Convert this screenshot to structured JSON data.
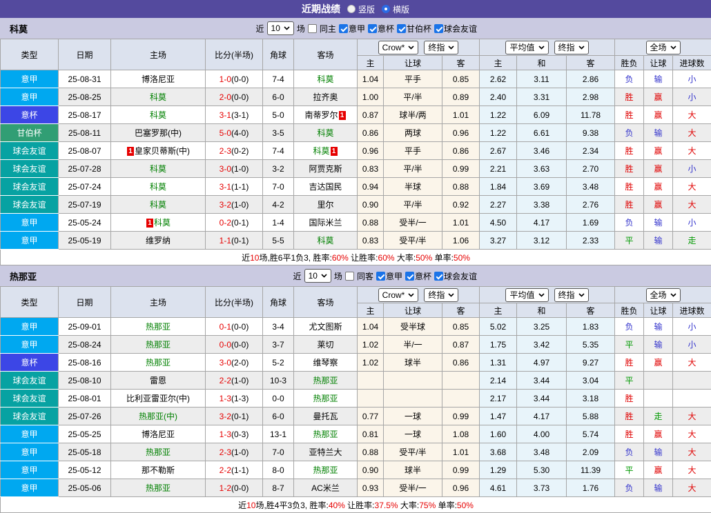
{
  "title_bar": {
    "title": "近期战绩",
    "radio_vertical": {
      "label": "竖版",
      "checked": false
    },
    "radio_horizontal": {
      "label": "横版",
      "checked": true
    }
  },
  "type_colors": {
    "意甲": "#00A8F0",
    "意杯": "#3C46E6",
    "甘伯杯": "#319E74",
    "球会友谊": "#07A2A2"
  },
  "result_colors": {
    "胜": "red",
    "负": "blue",
    "平": "green",
    "赢": "red",
    "输": "blue",
    "走": "green",
    "大": "red",
    "小": "blue"
  },
  "sections": [
    {
      "team": "科莫",
      "filter": {
        "near_label": "近",
        "count": "10",
        "games_label": "场",
        "same_label": "同主",
        "same_checked": false,
        "leagues": [
          {
            "label": "意甲",
            "checked": true
          },
          {
            "label": "意杯",
            "checked": true
          },
          {
            "label": "甘伯杯",
            "checked": true
          },
          {
            "label": "球会友谊",
            "checked": true
          }
        ]
      },
      "header": {
        "cols": [
          "类型",
          "日期",
          "主场",
          "比分(半场)",
          "角球",
          "客场"
        ],
        "selects": {
          "bookmaker": "Crow*",
          "ah_final": "终指",
          "eu_avg": "平均值",
          "eu_final": "终指",
          "scope": "全场"
        },
        "sub": [
          "主",
          "让球",
          "客",
          "主",
          "和",
          "客",
          "胜负",
          "让球",
          "进球数"
        ]
      },
      "rows": [
        {
          "type": "意甲",
          "date": "25-08-31",
          "home": "博洛尼亚",
          "home_green": false,
          "home_card": "",
          "score": "1-0",
          "half": "(0-0)",
          "corner": "7-4",
          "away": "科莫",
          "away_green": true,
          "away_card": "",
          "ah": [
            "1.04",
            "平手",
            "0.85"
          ],
          "eu": [
            "2.62",
            "3.11",
            "2.86"
          ],
          "res": [
            "负",
            "输",
            "小"
          ]
        },
        {
          "type": "意甲",
          "date": "25-08-25",
          "home": "科莫",
          "home_green": true,
          "home_card": "",
          "score": "2-0",
          "half": "(0-0)",
          "corner": "6-0",
          "away": "拉齐奥",
          "away_green": false,
          "away_card": "",
          "ah": [
            "1.00",
            "平/半",
            "0.89"
          ],
          "eu": [
            "2.40",
            "3.31",
            "2.98"
          ],
          "res": [
            "胜",
            "赢",
            "小"
          ]
        },
        {
          "type": "意杯",
          "date": "25-08-17",
          "home": "科莫",
          "home_green": true,
          "home_card": "",
          "score": "3-1",
          "half": "(3-1)",
          "corner": "5-0",
          "away": "南蒂罗尔",
          "away_green": false,
          "away_card": "1",
          "ah": [
            "0.87",
            "球半/两",
            "1.01"
          ],
          "eu": [
            "1.22",
            "6.09",
            "11.78"
          ],
          "res": [
            "胜",
            "赢",
            "大"
          ]
        },
        {
          "type": "甘伯杯",
          "date": "25-08-11",
          "home": "巴塞罗那(中)",
          "home_green": false,
          "home_card": "",
          "score": "5-0",
          "half": "(4-0)",
          "corner": "3-5",
          "away": "科莫",
          "away_green": true,
          "away_card": "",
          "ah": [
            "0.86",
            "两球",
            "0.96"
          ],
          "eu": [
            "1.22",
            "6.61",
            "9.38"
          ],
          "res": [
            "负",
            "输",
            "大"
          ]
        },
        {
          "type": "球会友谊",
          "date": "25-08-07",
          "home": "皇家贝蒂斯(中)",
          "home_green": false,
          "home_card": "1",
          "score": "2-3",
          "half": "(0-2)",
          "corner": "7-4",
          "away": "科莫",
          "away_green": true,
          "away_card": "1",
          "ah": [
            "0.96",
            "平手",
            "0.86"
          ],
          "eu": [
            "2.67",
            "3.46",
            "2.34"
          ],
          "res": [
            "胜",
            "赢",
            "大"
          ]
        },
        {
          "type": "球会友谊",
          "date": "25-07-28",
          "home": "科莫",
          "home_green": true,
          "home_card": "",
          "score": "3-0",
          "half": "(1-0)",
          "corner": "3-2",
          "away": "阿贾克斯",
          "away_green": false,
          "away_card": "",
          "ah": [
            "0.83",
            "平/半",
            "0.99"
          ],
          "eu": [
            "2.21",
            "3.63",
            "2.70"
          ],
          "res": [
            "胜",
            "赢",
            "小"
          ]
        },
        {
          "type": "球会友谊",
          "date": "25-07-24",
          "home": "科莫",
          "home_green": true,
          "home_card": "",
          "score": "3-1",
          "half": "(1-1)",
          "corner": "7-0",
          "away": "吉达国民",
          "away_green": false,
          "away_card": "",
          "ah": [
            "0.94",
            "半球",
            "0.88"
          ],
          "eu": [
            "1.84",
            "3.69",
            "3.48"
          ],
          "res": [
            "胜",
            "赢",
            "大"
          ]
        },
        {
          "type": "球会友谊",
          "date": "25-07-19",
          "home": "科莫",
          "home_green": true,
          "home_card": "",
          "score": "3-2",
          "half": "(1-0)",
          "corner": "4-2",
          "away": "里尔",
          "away_green": false,
          "away_card": "",
          "ah": [
            "0.90",
            "平/半",
            "0.92"
          ],
          "eu": [
            "2.27",
            "3.38",
            "2.76"
          ],
          "res": [
            "胜",
            "赢",
            "大"
          ]
        },
        {
          "type": "意甲",
          "date": "25-05-24",
          "home": "科莫",
          "home_green": true,
          "home_card": "1",
          "score": "0-2",
          "half": "(0-1)",
          "corner": "1-4",
          "away": "国际米兰",
          "away_green": false,
          "away_card": "",
          "ah": [
            "0.88",
            "受半/一",
            "1.01"
          ],
          "eu": [
            "4.50",
            "4.17",
            "1.69"
          ],
          "res": [
            "负",
            "输",
            "小"
          ]
        },
        {
          "type": "意甲",
          "date": "25-05-19",
          "home": "维罗纳",
          "home_green": false,
          "home_card": "",
          "score": "1-1",
          "half": "(0-1)",
          "corner": "5-5",
          "away": "科莫",
          "away_green": true,
          "away_card": "",
          "ah": [
            "0.83",
            "受平/半",
            "1.06"
          ],
          "eu": [
            "3.27",
            "3.12",
            "2.33"
          ],
          "res": [
            "平",
            "输",
            "走"
          ]
        }
      ],
      "summary": [
        {
          "text": "近",
          "red": false
        },
        {
          "text": "10",
          "red": true
        },
        {
          "text": "场,胜6平1负3, 胜率:",
          "red": false
        },
        {
          "text": "60%",
          "red": true
        },
        {
          "text": " 让胜率:",
          "red": false
        },
        {
          "text": "60%",
          "red": true
        },
        {
          "text": " 大率:",
          "red": false
        },
        {
          "text": "50%",
          "red": true
        },
        {
          "text": " 单率:",
          "red": false
        },
        {
          "text": "50%",
          "red": true
        }
      ]
    },
    {
      "team": "热那亚",
      "filter": {
        "near_label": "近",
        "count": "10",
        "games_label": "场",
        "same_label": "同客",
        "same_checked": false,
        "leagues": [
          {
            "label": "意甲",
            "checked": true
          },
          {
            "label": "意杯",
            "checked": true
          },
          {
            "label": "球会友谊",
            "checked": true
          }
        ]
      },
      "header": {
        "cols": [
          "类型",
          "日期",
          "主场",
          "比分(半场)",
          "角球",
          "客场"
        ],
        "selects": {
          "bookmaker": "Crow*",
          "ah_final": "终指",
          "eu_avg": "平均值",
          "eu_final": "终指",
          "scope": "全场"
        },
        "sub": [
          "主",
          "让球",
          "客",
          "主",
          "和",
          "客",
          "胜负",
          "让球",
          "进球数"
        ]
      },
      "rows": [
        {
          "type": "意甲",
          "date": "25-09-01",
          "home": "热那亚",
          "home_green": true,
          "home_card": "",
          "score": "0-1",
          "half": "(0-0)",
          "corner": "3-4",
          "away": "尤文图斯",
          "away_green": false,
          "away_card": "",
          "ah": [
            "1.04",
            "受半球",
            "0.85"
          ],
          "eu": [
            "5.02",
            "3.25",
            "1.83"
          ],
          "res": [
            "负",
            "输",
            "小"
          ]
        },
        {
          "type": "意甲",
          "date": "25-08-24",
          "home": "热那亚",
          "home_green": true,
          "home_card": "",
          "score": "0-0",
          "half": "(0-0)",
          "corner": "3-7",
          "away": "莱切",
          "away_green": false,
          "away_card": "",
          "ah": [
            "1.02",
            "半/一",
            "0.87"
          ],
          "eu": [
            "1.75",
            "3.42",
            "5.35"
          ],
          "res": [
            "平",
            "输",
            "小"
          ]
        },
        {
          "type": "意杯",
          "date": "25-08-16",
          "home": "热那亚",
          "home_green": true,
          "home_card": "",
          "score": "3-0",
          "half": "(2-0)",
          "corner": "5-2",
          "away": "维琴察",
          "away_green": false,
          "away_card": "",
          "ah": [
            "1.02",
            "球半",
            "0.86"
          ],
          "eu": [
            "1.31",
            "4.97",
            "9.27"
          ],
          "res": [
            "胜",
            "赢",
            "大"
          ]
        },
        {
          "type": "球会友谊",
          "date": "25-08-10",
          "home": "雷恩",
          "home_green": false,
          "home_card": "",
          "score": "2-2",
          "half": "(1-0)",
          "corner": "10-3",
          "away": "热那亚",
          "away_green": true,
          "away_card": "",
          "ah": [
            "",
            "",
            ""
          ],
          "eu": [
            "2.14",
            "3.44",
            "3.04"
          ],
          "res": [
            "平",
            "",
            ""
          ]
        },
        {
          "type": "球会友谊",
          "date": "25-08-01",
          "home": "比利亚雷亚尔(中)",
          "home_green": false,
          "home_card": "",
          "score": "1-3",
          "half": "(1-3)",
          "corner": "0-0",
          "away": "热那亚",
          "away_green": true,
          "away_card": "",
          "ah": [
            "",
            "",
            ""
          ],
          "eu": [
            "2.17",
            "3.44",
            "3.18"
          ],
          "res": [
            "胜",
            "",
            ""
          ]
        },
        {
          "type": "球会友谊",
          "date": "25-07-26",
          "home": "热那亚(中)",
          "home_green": true,
          "home_card": "",
          "score": "3-2",
          "half": "(0-1)",
          "corner": "6-0",
          "away": "曼托瓦",
          "away_green": false,
          "away_card": "",
          "ah": [
            "0.77",
            "一球",
            "0.99"
          ],
          "eu": [
            "1.47",
            "4.17",
            "5.88"
          ],
          "res": [
            "胜",
            "走",
            "大"
          ]
        },
        {
          "type": "意甲",
          "date": "25-05-25",
          "home": "博洛尼亚",
          "home_green": false,
          "home_card": "",
          "score": "1-3",
          "half": "(0-3)",
          "corner": "13-1",
          "away": "热那亚",
          "away_green": true,
          "away_card": "",
          "ah": [
            "0.81",
            "一球",
            "1.08"
          ],
          "eu": [
            "1.60",
            "4.00",
            "5.74"
          ],
          "res": [
            "胜",
            "赢",
            "大"
          ]
        },
        {
          "type": "意甲",
          "date": "25-05-18",
          "home": "热那亚",
          "home_green": true,
          "home_card": "",
          "score": "2-3",
          "half": "(1-0)",
          "corner": "7-0",
          "away": "亚特兰大",
          "away_green": false,
          "away_card": "",
          "ah": [
            "0.88",
            "受平/半",
            "1.01"
          ],
          "eu": [
            "3.68",
            "3.48",
            "2.09"
          ],
          "res": [
            "负",
            "输",
            "大"
          ]
        },
        {
          "type": "意甲",
          "date": "25-05-12",
          "home": "那不勒斯",
          "home_green": false,
          "home_card": "",
          "score": "2-2",
          "half": "(1-1)",
          "corner": "8-0",
          "away": "热那亚",
          "away_green": true,
          "away_card": "",
          "ah": [
            "0.90",
            "球半",
            "0.99"
          ],
          "eu": [
            "1.29",
            "5.30",
            "11.39"
          ],
          "res": [
            "平",
            "赢",
            "大"
          ]
        },
        {
          "type": "意甲",
          "date": "25-05-06",
          "home": "热那亚",
          "home_green": true,
          "home_card": "",
          "score": "1-2",
          "half": "(0-0)",
          "corner": "8-7",
          "away": "AC米兰",
          "away_green": false,
          "away_card": "",
          "ah": [
            "0.93",
            "受半/一",
            "0.96"
          ],
          "eu": [
            "4.61",
            "3.73",
            "1.76"
          ],
          "res": [
            "负",
            "输",
            "大"
          ]
        }
      ],
      "summary": [
        {
          "text": "近",
          "red": false
        },
        {
          "text": "10",
          "red": true
        },
        {
          "text": "场,胜4平3负3, 胜率:",
          "red": false
        },
        {
          "text": "40%",
          "red": true
        },
        {
          "text": " 让胜率:",
          "red": false
        },
        {
          "text": "37.5%",
          "red": true
        },
        {
          "text": " 大率:",
          "red": false
        },
        {
          "text": "75%",
          "red": true
        },
        {
          "text": " 单率:",
          "red": false
        },
        {
          "text": "50%",
          "red": true
        }
      ]
    }
  ]
}
